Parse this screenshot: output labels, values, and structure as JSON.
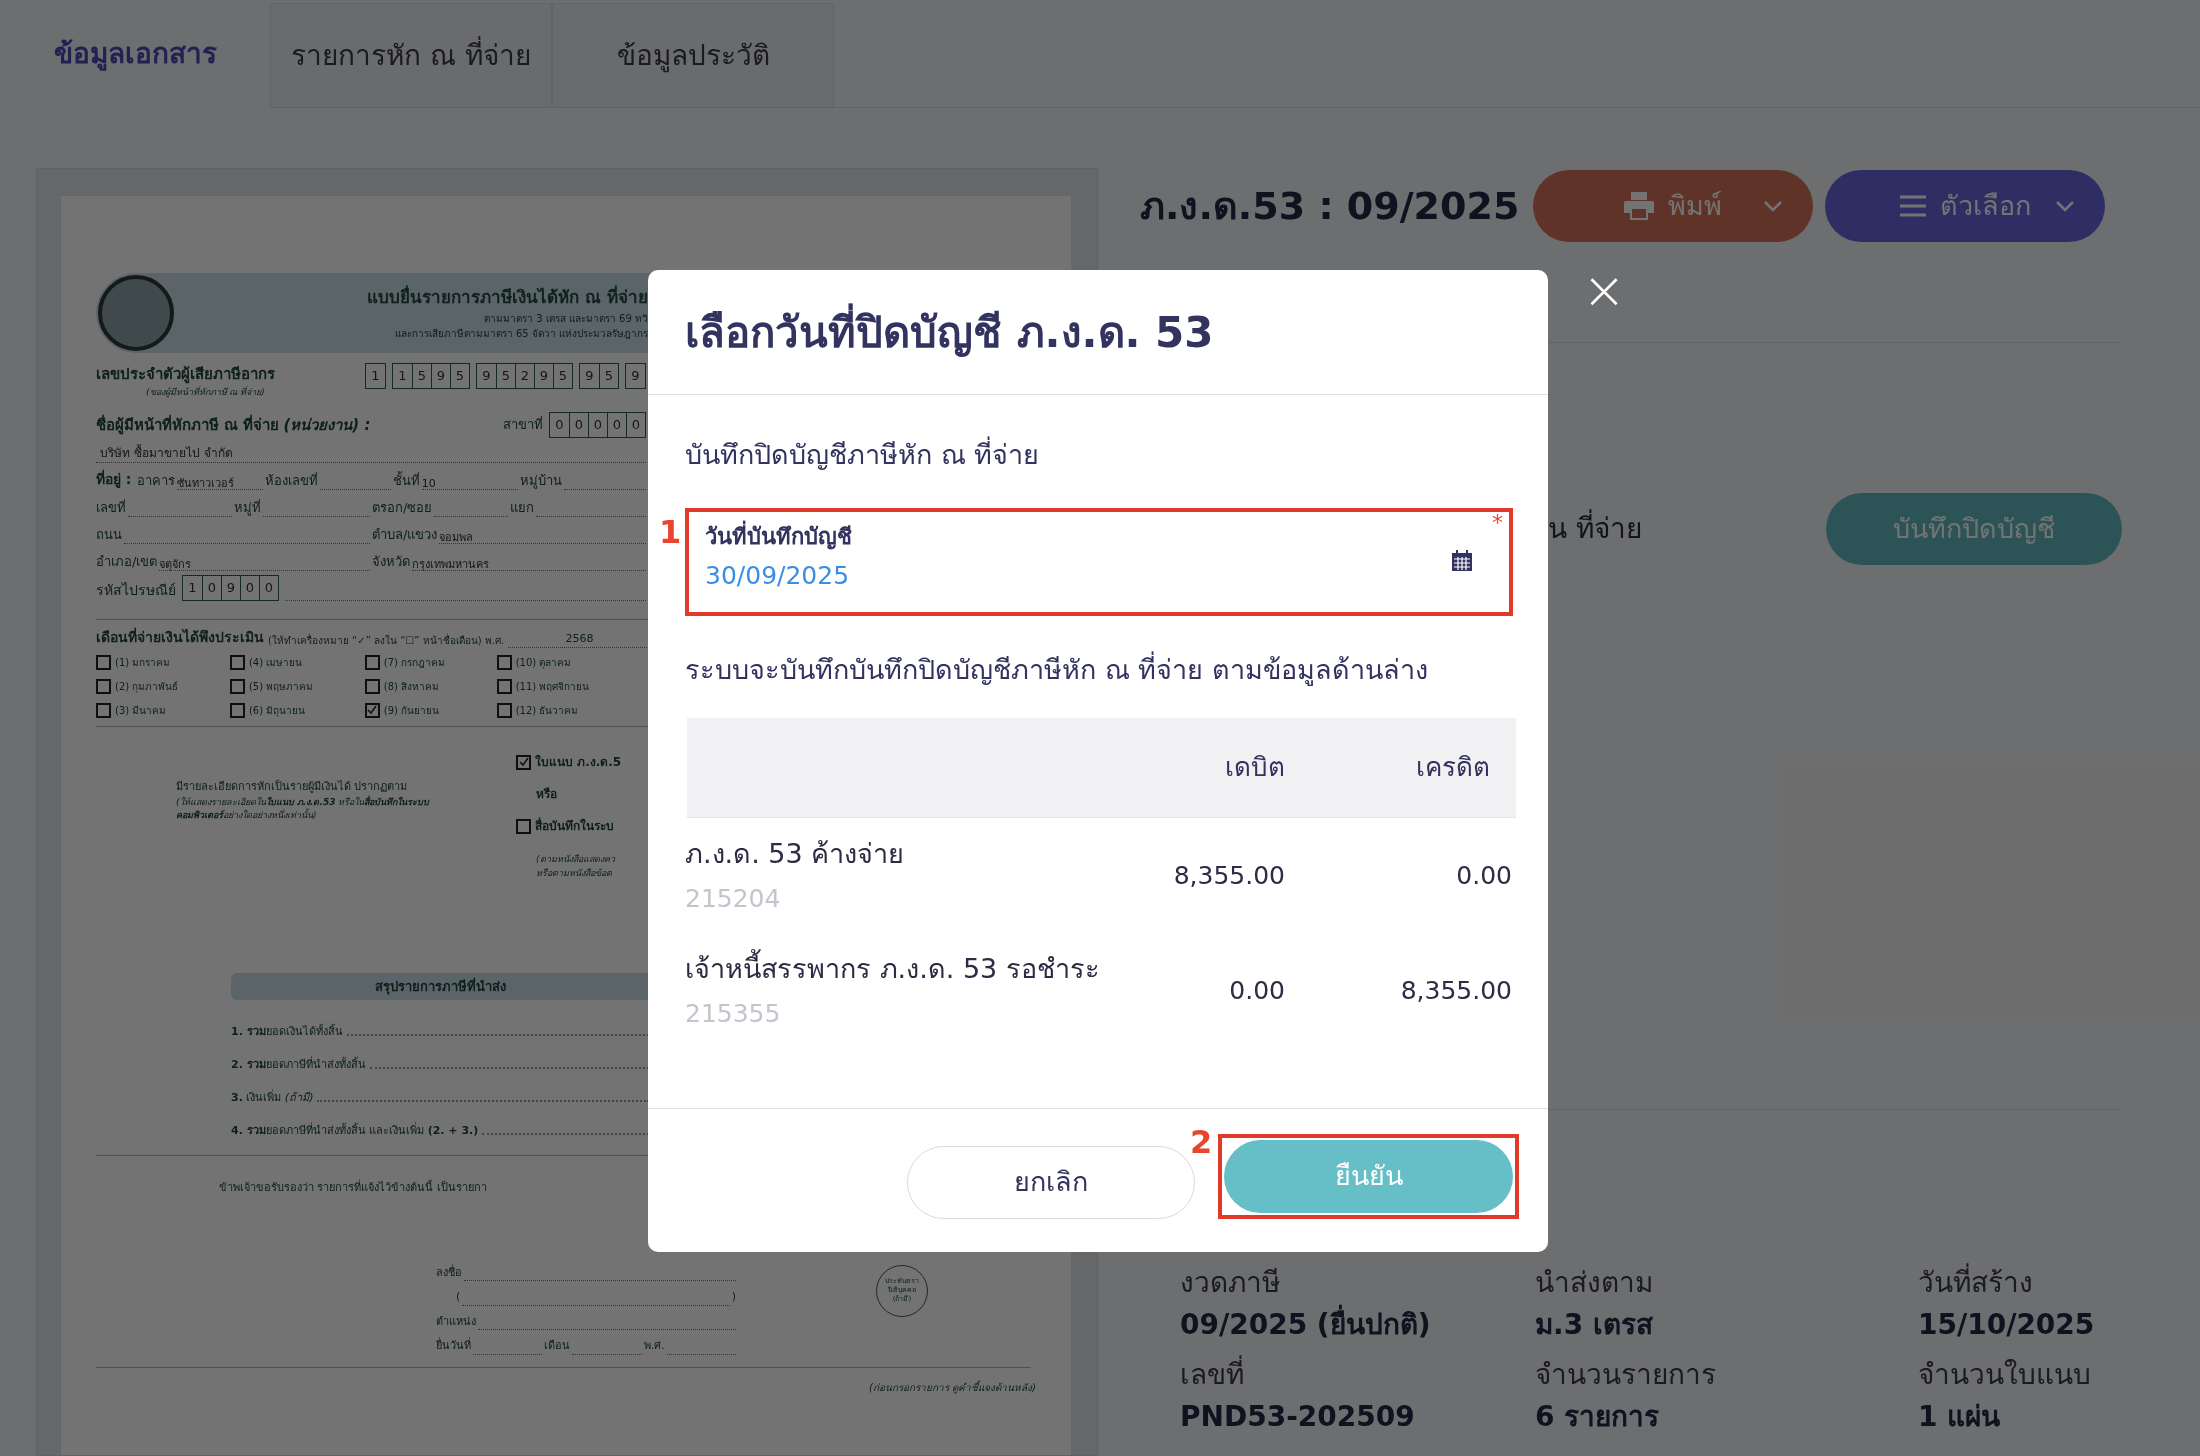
{
  "tabs": [
    {
      "label": "ข้อมูลเอกสาร",
      "selected": true
    },
    {
      "label": "รายการหัก ณ ที่จ่าย",
      "selected": false
    },
    {
      "label": "ข้อมูลประวัติ",
      "selected": false
    }
  ],
  "document_preview": {
    "header": {
      "title": "แบบยื่นรายการภาษีเงินได้หัก ณ ที่จ่าย",
      "subtitle_1": "ตามมาตรา 3 เตรส และมาตรา 69 ทวิ",
      "subtitle_2": "และการเสียภาษีตามมาตรา 65 จัตวา แห่งประมวลรัษฎากร"
    },
    "tax_id": {
      "label": "เลขประจำตัวผู้เสียภาษีอากร",
      "note": "(ของผู้มีหน้าที่หักภาษี ณ ที่จ่าย)",
      "digit_groups": [
        [
          "1"
        ],
        [
          "1",
          "5",
          "9",
          "5"
        ],
        [
          "9",
          "5",
          "2",
          "9",
          "5"
        ],
        [
          "9",
          "5"
        ],
        [
          "9"
        ]
      ]
    },
    "payer": {
      "label": "ชื่อผู้มีหน้าที่หักภาษี ณ ที่จ่าย",
      "label_note": "(หน่วยงาน) :",
      "branch_label": "สาขาที่",
      "branch_digits": [
        "0",
        "0",
        "0",
        "0",
        "0"
      ],
      "name": "บริษัท ซื้อมาขายไป จำกัด"
    },
    "address_prefix": "ที่อยู่ :",
    "address_rows": [
      [
        {
          "label": "อาคาร",
          "value": "ซันทาวเวอร์"
        },
        {
          "label": "ห้องเลขที่"
        },
        {
          "label": "ชั้นที่",
          "value": "10"
        },
        {
          "label": "หมู่บ้าน"
        }
      ],
      [
        {
          "label": "เลขที่"
        },
        {
          "label": "หมู่ที่"
        },
        {
          "label": "ตรอก/ซอย"
        },
        {
          "label": "แยก"
        }
      ],
      [
        {
          "label": "ถนน"
        },
        {
          "label": "ตำบล/แขวง",
          "value": "จอมพล"
        }
      ],
      [
        {
          "label": "อำเภอ/เขต",
          "value": "จตุจักร"
        },
        {
          "label": "จังหวัด",
          "value": "กรุงเทพมหานคร"
        }
      ]
    ],
    "postcode": {
      "label": "รหัสไปรษณีย์",
      "digits": [
        "1",
        "0",
        "9",
        "0",
        "0"
      ]
    },
    "months": {
      "label": "เดือนที่จ่ายเงินได้พึงประเมิน",
      "note": "(ให้ทำเครื่องหมาย “✓” ลงใน “☐” หน้าชื่อเดือน) พ.ศ.",
      "year": "2568",
      "items": [
        {
          "label": "(1) มกราคม",
          "checked": false
        },
        {
          "label": "(2) กุมภาพันธ์",
          "checked": false
        },
        {
          "label": "(3) มีนาคม",
          "checked": false
        },
        {
          "label": "(4) เมษายน",
          "checked": false
        },
        {
          "label": "(5) พฤษภาคม",
          "checked": false
        },
        {
          "label": "(6) มิถุนายน",
          "checked": false
        },
        {
          "label": "(7) กรกฎาคม",
          "checked": false
        },
        {
          "label": "(8) สิงหาคม",
          "checked": false
        },
        {
          "label": "(9) กันยายน",
          "checked": true
        },
        {
          "label": "(10) ตุลาคม",
          "checked": false
        },
        {
          "label": "(11) พฤศจิกายน",
          "checked": false
        },
        {
          "label": "(12) ธันวาคม",
          "checked": false
        }
      ]
    },
    "attachment": {
      "detail": "มีรายละเอียดการหักเป็นรายผู้มีเงินได้ ปรากฏตาม",
      "detail_note": "(ให้แสดงรายละเอียดใน**ใบแนบ ภ.ง.ด.53** หรือใน**สื่อบันทึกในระบบคอมพิวเตอร์**อย่างใดอย่างหนึ่งเท่านั้น)",
      "options": [
        {
          "label": "ใบแนบ ภ.ง.ด.5",
          "checked": true
        },
        {
          "label": "สื่อบันทึกในระบ",
          "checked": false
        }
      ],
      "or_text": "หรือ",
      "notes": [
        "(ตามหนังสือแสดงคว",
        "หรือตามหนังสือข้อต"
      ]
    },
    "summary": {
      "title": "สรุปรายการภาษีที่นำส่ง",
      "items": [
        "**1. รวม**ยอดเงินได้ทั้งสิ้น",
        "**2. รวม**ยอดภาษีที่นำส่งทั้งสิ้น",
        "**3.** เงินเพิ่ม *(ถ้ามี)*",
        "**4. รวม**ยอดภาษีที่นำส่งทั้งสิ้น และเงินเพิ่ม **(2. + 3.)**"
      ]
    },
    "certification": "ข้าพเจ้าขอรับรองว่า รายการที่แจ้งไว้ข้างต้นนี้ เป็นรายกา",
    "signature": {
      "sign_label": "ลงชื่อ",
      "open_paren": "(",
      "close_paren": ")",
      "position_label": "ตำแหน่ง",
      "date_labels": [
        "ยื่นวันที่",
        "เดือน",
        "พ.ศ."
      ]
    },
    "stamp": [
      "ประทับตรา",
      "นิติบุคคล",
      "(ถ้ามี)"
    ],
    "footer_note": "(ก่อนกรอกรายการ ดูคำชี้แจงด้านหลัง)"
  },
  "summary_header": {
    "title": "ภ.ง.ด.53 : 09/2025",
    "print_button": "พิมพ์",
    "options_button": "ตัวเลือก"
  },
  "closing_row": {
    "text": "น ที่จ่าย",
    "button": "บันทึกปิดบัญชี"
  },
  "info": [
    {
      "label": "งวดภาษี",
      "value": "09/2025 (ยื่นปกติ)"
    },
    {
      "label": "นำส่งตาม",
      "value": "ม.3 เตรส"
    },
    {
      "label": "วันที่สร้าง",
      "value": "15/10/2025"
    },
    {
      "label": "เลขที่",
      "value": "PND53-202509"
    },
    {
      "label": "จำนวนรายการ",
      "value": "6 รายการ"
    },
    {
      "label": "จำนวนใบแนบ",
      "value": "1 แผ่น"
    }
  ],
  "modal": {
    "title": "เลือกวันที่ปิดบัญชี ภ.ง.ด. 53",
    "subtitle": "บันทึกปิดบัญชีภาษีหัก ณ ที่จ่าย",
    "date_field": {
      "label": "วันที่บันทึกบัญชี",
      "value": "30/09/2025",
      "required_mark": "*",
      "callout": "1"
    },
    "description": "ระบบจะบันทึกบันทึกปิดบัญชีภาษีหัก ณ ที่จ่าย ตามข้อมูลด้านล่าง",
    "table": {
      "columns": [
        "เดบิต",
        "เครดิต"
      ],
      "rows": [
        {
          "account": "ภ.ง.ด. 53 ค้างจ่าย",
          "code": "215204",
          "debit": "8,355.00",
          "credit": "0.00"
        },
        {
          "account": "เจ้าหนี้สรรพากร ภ.ง.ด. 53 รอชำระ",
          "code": "215355",
          "debit": "0.00",
          "credit": "8,355.00"
        }
      ]
    },
    "cancel_button": "ยกเลิก",
    "confirm_button": "ยืนยัน",
    "confirm_callout": "2",
    "close_button": "×"
  }
}
